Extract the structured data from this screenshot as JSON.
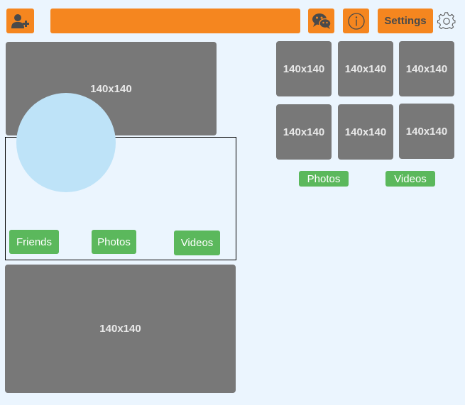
{
  "toolbar": {
    "add_user_icon": "add-user-icon",
    "search_value": "",
    "chat_icon": "wechat-icon",
    "info_icon": "info-icon",
    "settings_label": "Settings",
    "gear_icon": "gear-icon"
  },
  "profile": {
    "cover_label": "140x140",
    "avatar_color": "#bee3f8",
    "buttons": {
      "friends": "Friends",
      "photos": "Photos",
      "videos": "Videos"
    },
    "bottom_label": "140x140"
  },
  "gallery": {
    "thumbs": [
      "140x140",
      "140x140",
      "140x140",
      "140x140",
      "140x140",
      "140x140"
    ],
    "photos_label": "Photos",
    "videos_label": "Videos"
  },
  "colors": {
    "accent": "#f5861f",
    "success": "#5bb85c",
    "placeholder": "#787878",
    "background": "#ebf5fe"
  }
}
